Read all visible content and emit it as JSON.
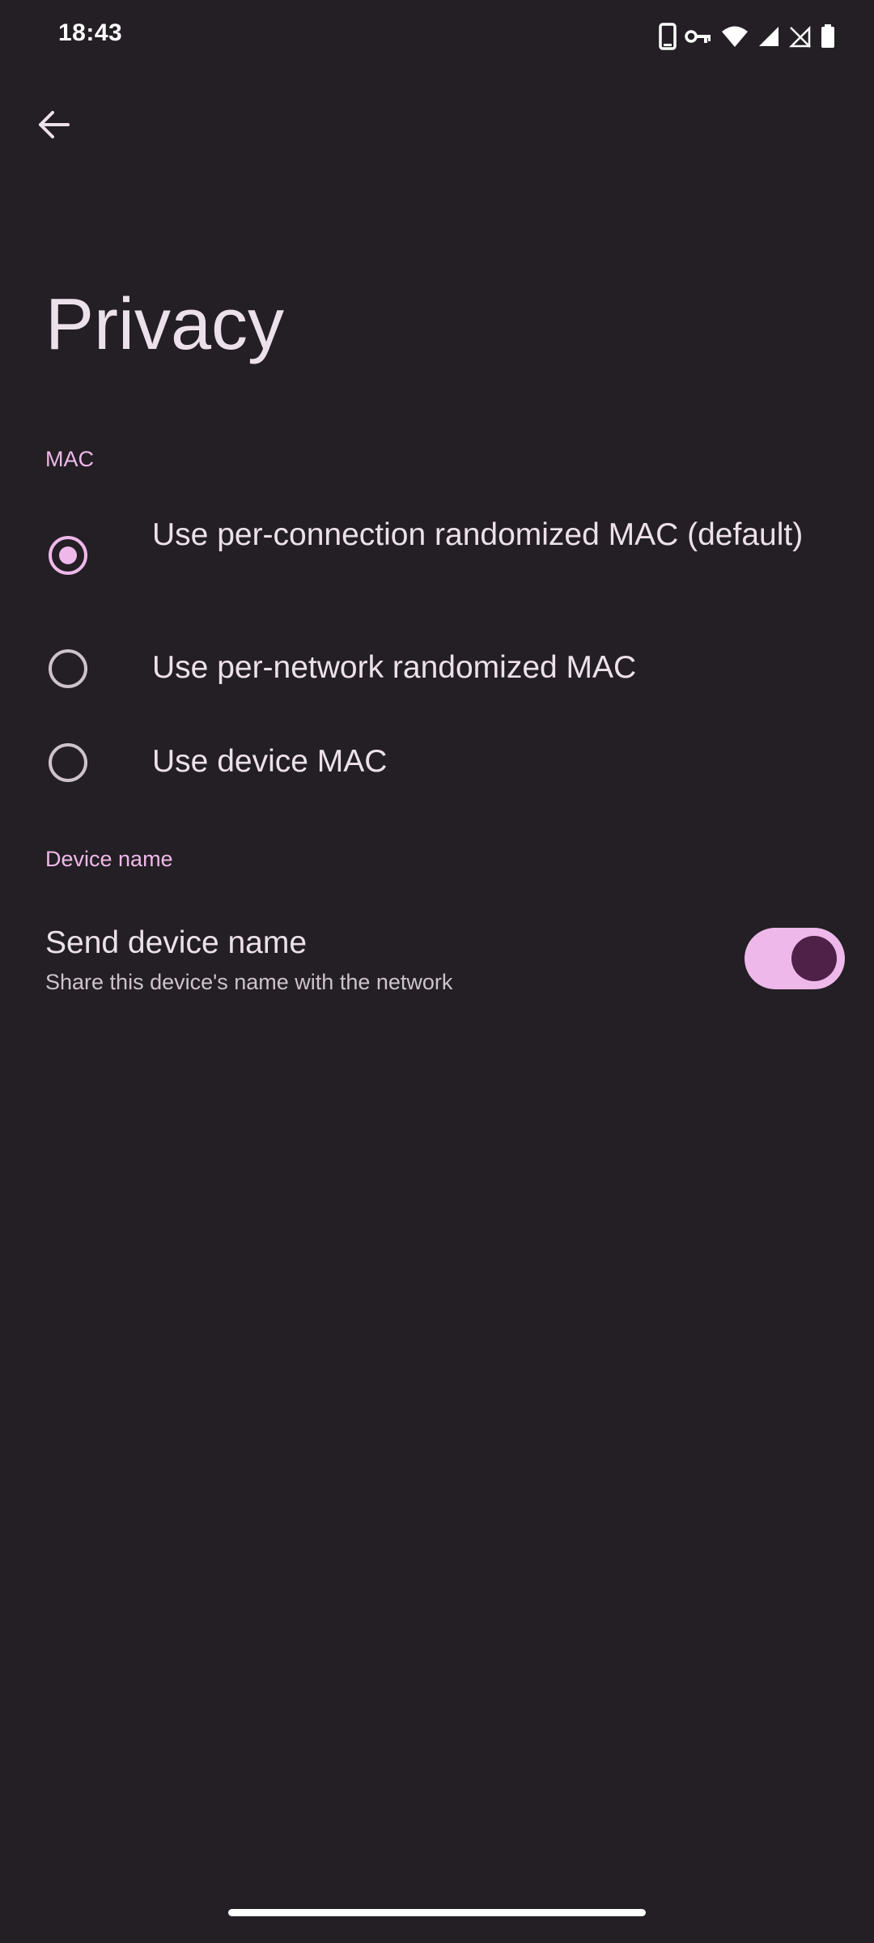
{
  "status_bar": {
    "time": "18:43",
    "icons": [
      "phone-icon",
      "vpn-key-icon",
      "wifi-icon",
      "cell-signal-icon",
      "no-data-icon",
      "battery-icon"
    ]
  },
  "header": {
    "back_icon": "arrow-back-icon",
    "title": "Privacy"
  },
  "mac_section": {
    "header": "MAC",
    "options": [
      {
        "label": "Use per-connection randomized MAC (default)",
        "selected": true
      },
      {
        "label": "Use per-network randomized MAC",
        "selected": false
      },
      {
        "label": "Use device MAC",
        "selected": false
      }
    ]
  },
  "device_name_section": {
    "header": "Device name",
    "send_device_name": {
      "title": "Send device name",
      "summary": "Share this device's name with the network",
      "enabled": true
    }
  },
  "colors": {
    "background": "#231f24",
    "accent": "#efb8ea",
    "toggle_thumb": "#4f2148",
    "text_primary": "#ece1ea",
    "text_secondary": "#cdc3cc"
  }
}
